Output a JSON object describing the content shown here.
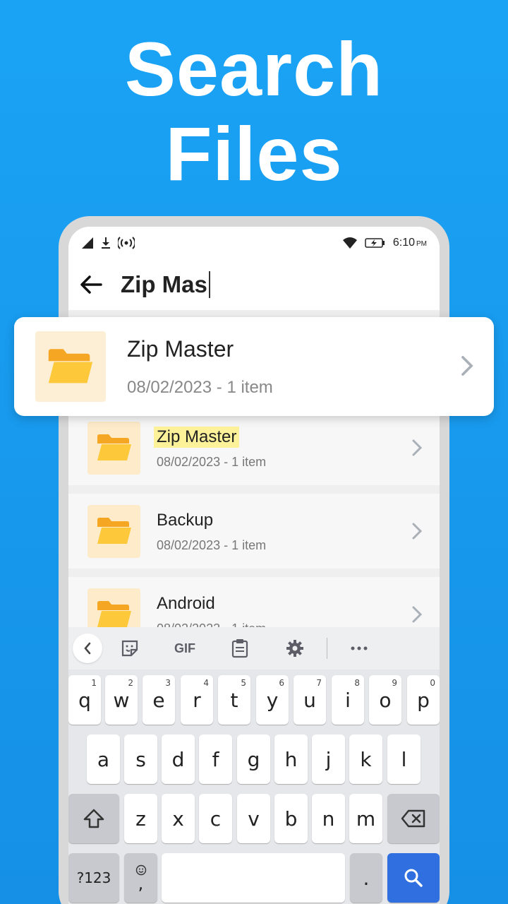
{
  "headline": {
    "line1": "Search",
    "line2": "Files"
  },
  "status": {
    "time": "6:10",
    "ampm": "PM"
  },
  "search": {
    "query": "Zip Mas"
  },
  "featured": {
    "name": "Zip Master",
    "meta": "08/02/2023 - 1 item"
  },
  "results": [
    {
      "name": "Zip Master",
      "meta": "08/02/2023 - 1 item",
      "highlight": true
    },
    {
      "name": "Backup",
      "meta": "08/02/2023 - 1 item",
      "highlight": false
    },
    {
      "name": "Android",
      "meta": "08/02/2023 - 1 item",
      "highlight": false
    }
  ],
  "keyboard": {
    "toolbar": {
      "gif": "GIF"
    },
    "row1": [
      {
        "k": "q",
        "n": "1"
      },
      {
        "k": "w",
        "n": "2"
      },
      {
        "k": "e",
        "n": "3"
      },
      {
        "k": "r",
        "n": "4"
      },
      {
        "k": "t",
        "n": "5"
      },
      {
        "k": "y",
        "n": "6"
      },
      {
        "k": "u",
        "n": "7"
      },
      {
        "k": "i",
        "n": "8"
      },
      {
        "k": "o",
        "n": "9"
      },
      {
        "k": "p",
        "n": "0"
      }
    ],
    "row2": [
      "a",
      "s",
      "d",
      "f",
      "g",
      "h",
      "j",
      "k",
      "l"
    ],
    "row3": [
      "z",
      "x",
      "c",
      "v",
      "b",
      "n",
      "m"
    ],
    "symbols_label": "?123",
    "comma": ",",
    "period": "."
  },
  "colors": {
    "background": "#1aa3f5",
    "folder": "#fdb32a",
    "highlight": "#fdf29a",
    "search_key": "#2f6fe0"
  }
}
